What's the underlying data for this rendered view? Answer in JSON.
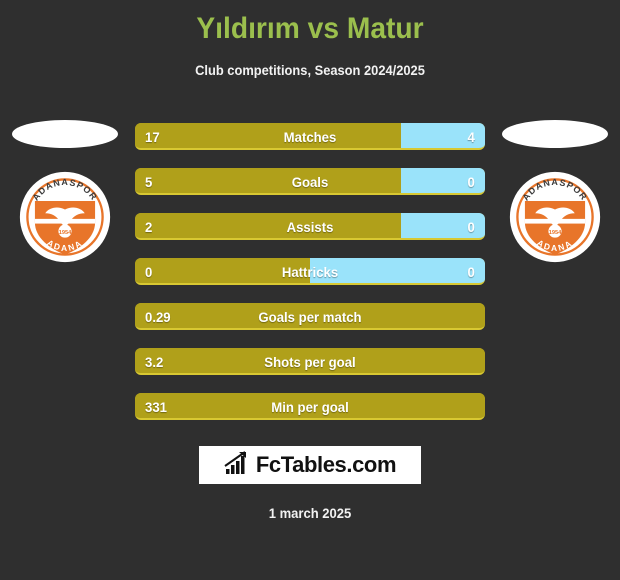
{
  "header": {
    "title": "Yıldırım vs Matur",
    "subtitle": "Club competitions, Season 2024/2025",
    "title_color": "#9bbf4d"
  },
  "teams": {
    "home": {
      "badge_name": "ADANASPOR",
      "badge_city": "ADANA",
      "badge_year": "1954",
      "primary_color": "#e8752a",
      "bar_color": "#b0a01a"
    },
    "away": {
      "badge_name": "ADANASPOR",
      "badge_city": "ADANA",
      "badge_year": "1954",
      "primary_color": "#e8752a",
      "bar_color": "#9ae3fa"
    }
  },
  "chart_data": {
    "type": "bar",
    "title": "Yıldırım vs Matur",
    "subtitle": "Club competitions, Season 2024/2025",
    "categories": [
      "Matches",
      "Goals",
      "Assists",
      "Hattricks",
      "Goals per match",
      "Shots per goal",
      "Min per goal"
    ],
    "series": [
      {
        "name": "Yıldırım",
        "values": [
          17,
          5,
          2,
          0,
          0.29,
          3.2,
          331
        ],
        "color": "#b0a01a"
      },
      {
        "name": "Matur",
        "values": [
          4,
          0,
          0,
          0,
          null,
          null,
          null
        ],
        "color": "#9ae3fa"
      }
    ],
    "legend_position": "none",
    "grid": false
  },
  "rows": [
    {
      "label": "Matches",
      "home": "17",
      "away": "4",
      "home_pct": 76,
      "has_away": true
    },
    {
      "label": "Goals",
      "home": "5",
      "away": "0",
      "home_pct": 76,
      "has_away": true
    },
    {
      "label": "Assists",
      "home": "2",
      "away": "0",
      "home_pct": 76,
      "has_away": true
    },
    {
      "label": "Hattricks",
      "home": "0",
      "away": "0",
      "home_pct": 50,
      "has_away": true
    },
    {
      "label": "Goals per match",
      "home": "0.29",
      "away": "",
      "home_pct": 100,
      "has_away": false
    },
    {
      "label": "Shots per goal",
      "home": "3.2",
      "away": "",
      "home_pct": 100,
      "has_away": false
    },
    {
      "label": "Min per goal",
      "home": "331",
      "away": "",
      "home_pct": 100,
      "has_away": false
    }
  ],
  "footer": {
    "logo_text": "FcTables.com",
    "logo_icon": "bar-chart-growth-icon",
    "date": "1 march 2025"
  }
}
